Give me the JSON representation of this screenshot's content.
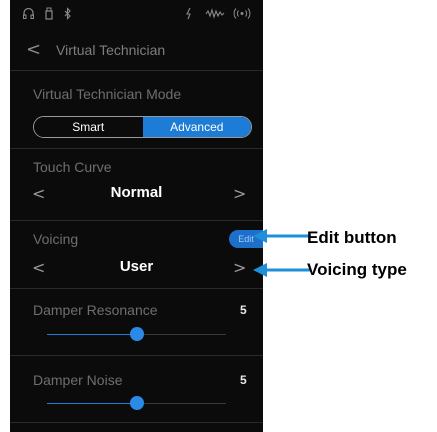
{
  "status_bar": {
    "icons": [
      "headphones-icon",
      "usb-icon",
      "bluetooth-icon",
      "audio-icon",
      "waveform-icon",
      "wireless-icon"
    ]
  },
  "header": {
    "back_glyph": "<",
    "title": "Virtual Technician"
  },
  "mode": {
    "label": "Virtual Technician Mode",
    "options": [
      "Smart",
      "Advanced"
    ],
    "selected": "Advanced"
  },
  "touch_curve": {
    "label": "Touch Curve",
    "prev_glyph": "<",
    "value": "Normal",
    "next_glyph": ">"
  },
  "voicing": {
    "label": "Voicing",
    "edit_label": "Edit",
    "prev_glyph": "<",
    "value": "User",
    "next_glyph": ">"
  },
  "damper_resonance": {
    "label": "Damper Resonance",
    "value": "5",
    "level": 0.5
  },
  "damper_noise": {
    "label": "Damper Noise",
    "value": "5",
    "level": 0.5
  },
  "annotations": {
    "edit_button": "Edit button",
    "voicing_type": "Voicing type"
  },
  "colors": {
    "accent": "#1c7cd6",
    "background": "#0b0b0b",
    "annotation_arrow": "#1e8fd8"
  }
}
